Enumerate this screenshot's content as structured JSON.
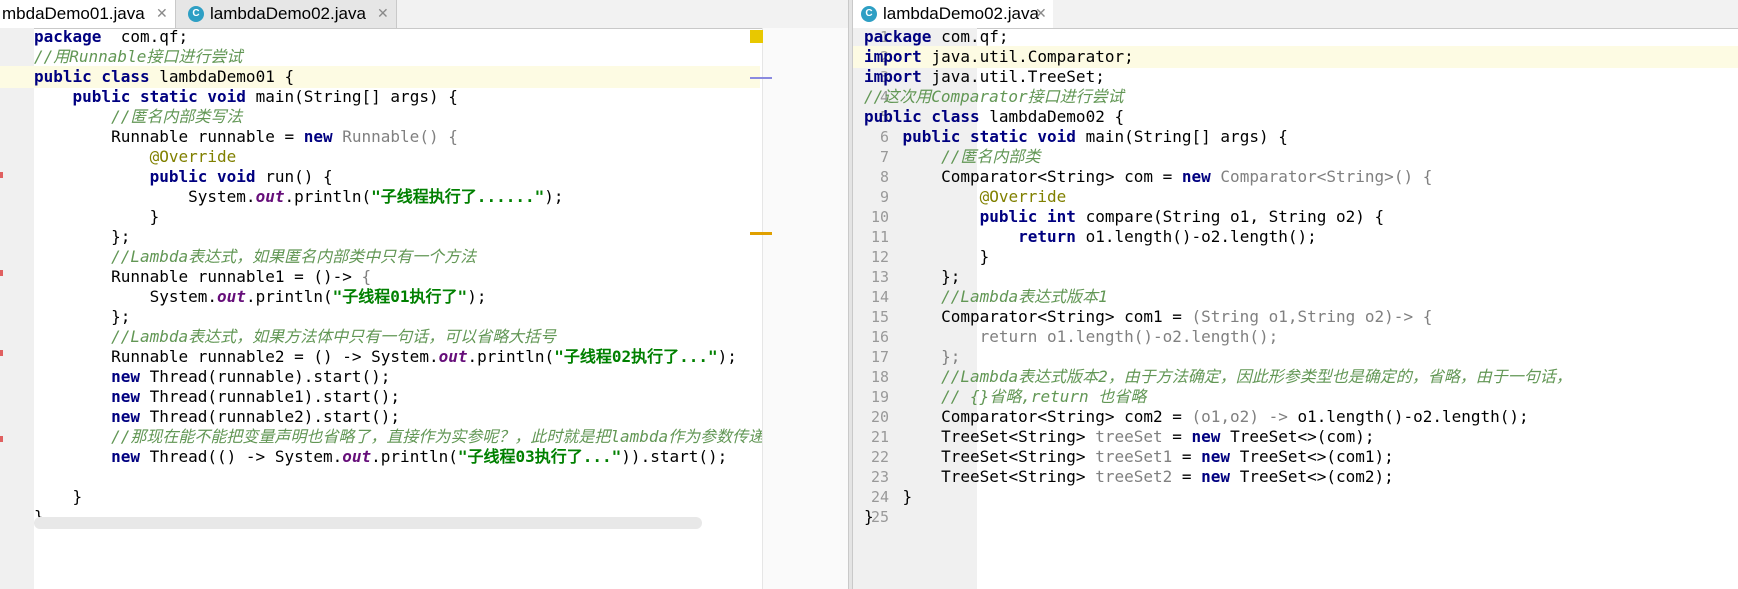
{
  "left_editor": {
    "tabs": [
      {
        "label": "mbdaDemo01.java",
        "active": true
      },
      {
        "label": "lambdaDemo02.java",
        "active": false
      }
    ],
    "lines": [
      {
        "tokens": [
          [
            "kw",
            "package"
          ],
          [
            "",
            "  com.qf;"
          ]
        ]
      },
      {
        "tokens": [
          [
            "cm",
            "//用Runnable接口进行尝试"
          ]
        ]
      },
      {
        "tokens": [
          [
            "kw",
            "public class "
          ],
          [
            "",
            "lambdaDemo01 {"
          ]
        ]
      },
      {
        "tokens": [
          [
            "",
            "    "
          ],
          [
            "kw",
            "public static void "
          ],
          [
            "",
            "main(String[] args) {"
          ]
        ]
      },
      {
        "tokens": [
          [
            "",
            "        "
          ],
          [
            "cm",
            "//匿名内部类写法"
          ]
        ]
      },
      {
        "tokens": [
          [
            "",
            "        Runnable runnable = "
          ],
          [
            "kw",
            "new "
          ],
          [
            "gr",
            "Runnable() {"
          ]
        ]
      },
      {
        "tokens": [
          [
            "",
            "            "
          ],
          [
            "an",
            "@Override"
          ]
        ]
      },
      {
        "tokens": [
          [
            "",
            "            "
          ],
          [
            "kw",
            "public void "
          ],
          [
            "",
            "run() {"
          ]
        ]
      },
      {
        "tokens": [
          [
            "",
            "                System."
          ],
          [
            "st",
            "out"
          ],
          [
            "",
            ".println("
          ],
          [
            "str",
            "\"子线程执行了......\""
          ],
          [
            "",
            ");"
          ]
        ]
      },
      {
        "tokens": [
          [
            "",
            "            }"
          ]
        ]
      },
      {
        "tokens": [
          [
            "",
            "        };"
          ]
        ]
      },
      {
        "tokens": [
          [
            "",
            "        "
          ],
          [
            "cm",
            "//Lambda表达式，如果匿名内部类中只有一个方法"
          ]
        ]
      },
      {
        "tokens": [
          [
            "",
            "        Runnable runnable1 = ()-> "
          ],
          [
            "gr",
            "{"
          ]
        ]
      },
      {
        "tokens": [
          [
            "",
            "            System."
          ],
          [
            "st",
            "out"
          ],
          [
            "",
            ".println("
          ],
          [
            "str",
            "\"子线程01执行了\""
          ],
          [
            "",
            ");"
          ]
        ]
      },
      {
        "tokens": [
          [
            "",
            "        };"
          ]
        ]
      },
      {
        "tokens": [
          [
            "",
            "        "
          ],
          [
            "cm",
            "//Lambda表达式，如果方法体中只有一句话，可以省略大括号"
          ]
        ]
      },
      {
        "tokens": [
          [
            "",
            "        Runnable runnable2 = () -> System."
          ],
          [
            "st",
            "out"
          ],
          [
            "",
            ".println("
          ],
          [
            "str",
            "\"子线程02执行了...\""
          ],
          [
            "",
            ");"
          ]
        ]
      },
      {
        "tokens": [
          [
            "",
            "        "
          ],
          [
            "kw",
            "new "
          ],
          [
            "",
            "Thread(runnable).start();"
          ]
        ]
      },
      {
        "tokens": [
          [
            "",
            "        "
          ],
          [
            "kw",
            "new "
          ],
          [
            "",
            "Thread(runnable1).start();"
          ]
        ]
      },
      {
        "tokens": [
          [
            "",
            "        "
          ],
          [
            "kw",
            "new "
          ],
          [
            "",
            "Thread(runnable2).start();"
          ]
        ]
      },
      {
        "tokens": [
          [
            "",
            "        "
          ],
          [
            "cm",
            "//那现在能不能把变量声明也省略了，直接作为实参呢？，此时就是把lambda作为参数传递"
          ]
        ]
      },
      {
        "tokens": [
          [
            "",
            "        "
          ],
          [
            "kw",
            "new "
          ],
          [
            "",
            "Thread(() -> System."
          ],
          [
            "st",
            "out"
          ],
          [
            "",
            ".println("
          ],
          [
            "str",
            "\"子线程03执行了...\""
          ],
          [
            "",
            ")).start();"
          ]
        ]
      },
      {
        "tokens": []
      },
      {
        "tokens": [
          [
            "",
            "    }"
          ]
        ]
      },
      {
        "tokens": [
          [
            "",
            "}"
          ]
        ]
      }
    ]
  },
  "right_editor": {
    "tabs": [
      {
        "label": "lambdaDemo02.java",
        "active": true
      }
    ],
    "line_numbers": [
      "1",
      "2",
      "3",
      "4",
      "5",
      "6",
      "7",
      "8",
      "9",
      "10",
      "11",
      "12",
      "13",
      "14",
      "15",
      "16",
      "17",
      "18",
      "19",
      "20",
      "21",
      "22",
      "23",
      "24",
      "25"
    ],
    "lines": [
      {
        "tokens": [
          [
            "kw",
            "package "
          ],
          [
            "",
            "com.qf;"
          ]
        ]
      },
      {
        "tokens": [
          [
            "kw",
            "import "
          ],
          [
            "",
            "java.util.Comparator;"
          ]
        ]
      },
      {
        "tokens": [
          [
            "kw",
            "import "
          ],
          [
            "",
            "java.util.TreeSet;"
          ]
        ]
      },
      {
        "tokens": [
          [
            "cm",
            "//这次用Comparator接口进行尝试"
          ]
        ]
      },
      {
        "tokens": [
          [
            "kw",
            "public class "
          ],
          [
            "",
            "lambdaDemo02 {"
          ]
        ]
      },
      {
        "tokens": [
          [
            "",
            "    "
          ],
          [
            "kw",
            "public static void "
          ],
          [
            "",
            "main(String[] args) {"
          ]
        ]
      },
      {
        "tokens": [
          [
            "",
            "        "
          ],
          [
            "cm",
            "//匿名内部类"
          ]
        ]
      },
      {
        "tokens": [
          [
            "",
            "        Comparator<String> com = "
          ],
          [
            "kw",
            "new "
          ],
          [
            "gr",
            "Comparator<String>() {"
          ]
        ]
      },
      {
        "tokens": [
          [
            "",
            "            "
          ],
          [
            "an",
            "@Override"
          ]
        ]
      },
      {
        "tokens": [
          [
            "",
            "            "
          ],
          [
            "kw",
            "public int "
          ],
          [
            "",
            "compare(String o1, String o2) {"
          ]
        ]
      },
      {
        "tokens": [
          [
            "",
            "                "
          ],
          [
            "kw",
            "return "
          ],
          [
            "",
            "o1.length()-o2.length();"
          ]
        ]
      },
      {
        "tokens": [
          [
            "",
            "            }"
          ]
        ]
      },
      {
        "tokens": [
          [
            "",
            "        };"
          ]
        ]
      },
      {
        "tokens": [
          [
            "",
            "        "
          ],
          [
            "cm",
            "//Lambda表达式版本1"
          ]
        ]
      },
      {
        "tokens": [
          [
            "",
            "        Comparator<String> com1 = "
          ],
          [
            "gr",
            "(String o1,String o2)-> {"
          ]
        ]
      },
      {
        "tokens": [
          [
            "",
            "            "
          ],
          [
            "gr",
            "return "
          ],
          [
            "gr",
            "o1.length()-o2.length();"
          ]
        ]
      },
      {
        "tokens": [
          [
            "",
            "        "
          ],
          [
            "gr",
            "};"
          ]
        ]
      },
      {
        "tokens": [
          [
            "",
            "        "
          ],
          [
            "cm",
            "//Lambda表达式版本2，由于方法确定，因此形参类型也是确定的，省略，由于一句话，"
          ]
        ]
      },
      {
        "tokens": [
          [
            "",
            "        "
          ],
          [
            "cm",
            "// {}省略,return 也省略"
          ]
        ]
      },
      {
        "tokens": [
          [
            "",
            "        Comparator<String> com2 = "
          ],
          [
            "gr",
            "(o1,o2) -> "
          ],
          [
            "",
            "o1.length()-o2.length();"
          ]
        ]
      },
      {
        "tokens": [
          [
            "",
            "        TreeSet<String> "
          ],
          [
            "gr",
            "treeSet"
          ],
          [
            "",
            " = "
          ],
          [
            "kw",
            "new "
          ],
          [
            "",
            "TreeSet<>(com);"
          ]
        ]
      },
      {
        "tokens": [
          [
            "",
            "        TreeSet<String> "
          ],
          [
            "gr",
            "treeSet1"
          ],
          [
            "",
            " = "
          ],
          [
            "kw",
            "new "
          ],
          [
            "",
            "TreeSet<>(com1);"
          ]
        ]
      },
      {
        "tokens": [
          [
            "",
            "        TreeSet<String> "
          ],
          [
            "gr",
            "treeSet2"
          ],
          [
            "",
            " = "
          ],
          [
            "kw",
            "new "
          ],
          [
            "",
            "TreeSet<>(com2);"
          ]
        ]
      },
      {
        "tokens": [
          [
            "",
            "    }"
          ]
        ]
      },
      {
        "tokens": [
          [
            "",
            "}"
          ]
        ]
      }
    ],
    "gutter_marks": {
      "override_at": "@"
    }
  },
  "colors": {
    "keyword": "#000080",
    "comment": "#629755",
    "string": "#008000",
    "annotation": "#808000",
    "run_icon": "#3c9d5a"
  },
  "icon_names": [
    "java-class-icon",
    "close-icon",
    "run-icon",
    "override-icon",
    "lambda-icon",
    "fold-icon"
  ]
}
